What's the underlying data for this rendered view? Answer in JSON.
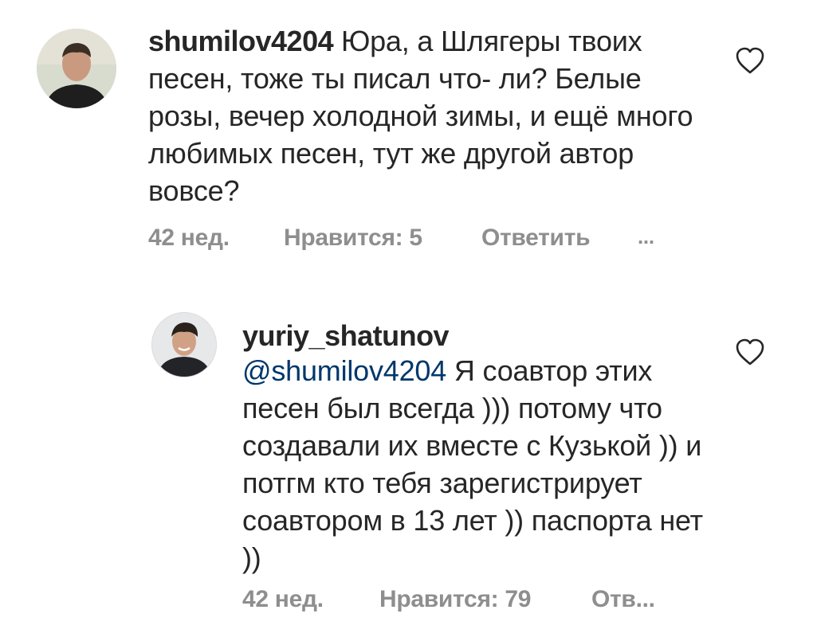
{
  "comments": [
    {
      "username": "shumilov4204",
      "text": "Юра, а Шлягеры твоих песен, тоже ты писал что- ли? Белые розы, вечер холодной зимы, и ещё много любимых песен, тут же другой автор вовсе?",
      "time": "42 нед.",
      "likes_label": "Нравится: 5",
      "reply_label": "Ответить",
      "more_label": "...",
      "like_icon": "heart-outline-icon"
    },
    {
      "username": "yuriy_shatunov",
      "mention": "@shumilov4204",
      "text": "Я соавтор этих песен был всегда ))) потому что создавали их вместе с Кузькой )) и потгм кто тебя зарегистрирует соавтором в 13 лет )) паспорта нет ))",
      "time": "42 нед.",
      "likes_label": "Нравится: 79",
      "reply_label": "Отв...",
      "like_icon": "heart-outline-icon"
    }
  ],
  "colors": {
    "text": "#262626",
    "meta": "#8e8e8e",
    "mention": "#00376b"
  }
}
